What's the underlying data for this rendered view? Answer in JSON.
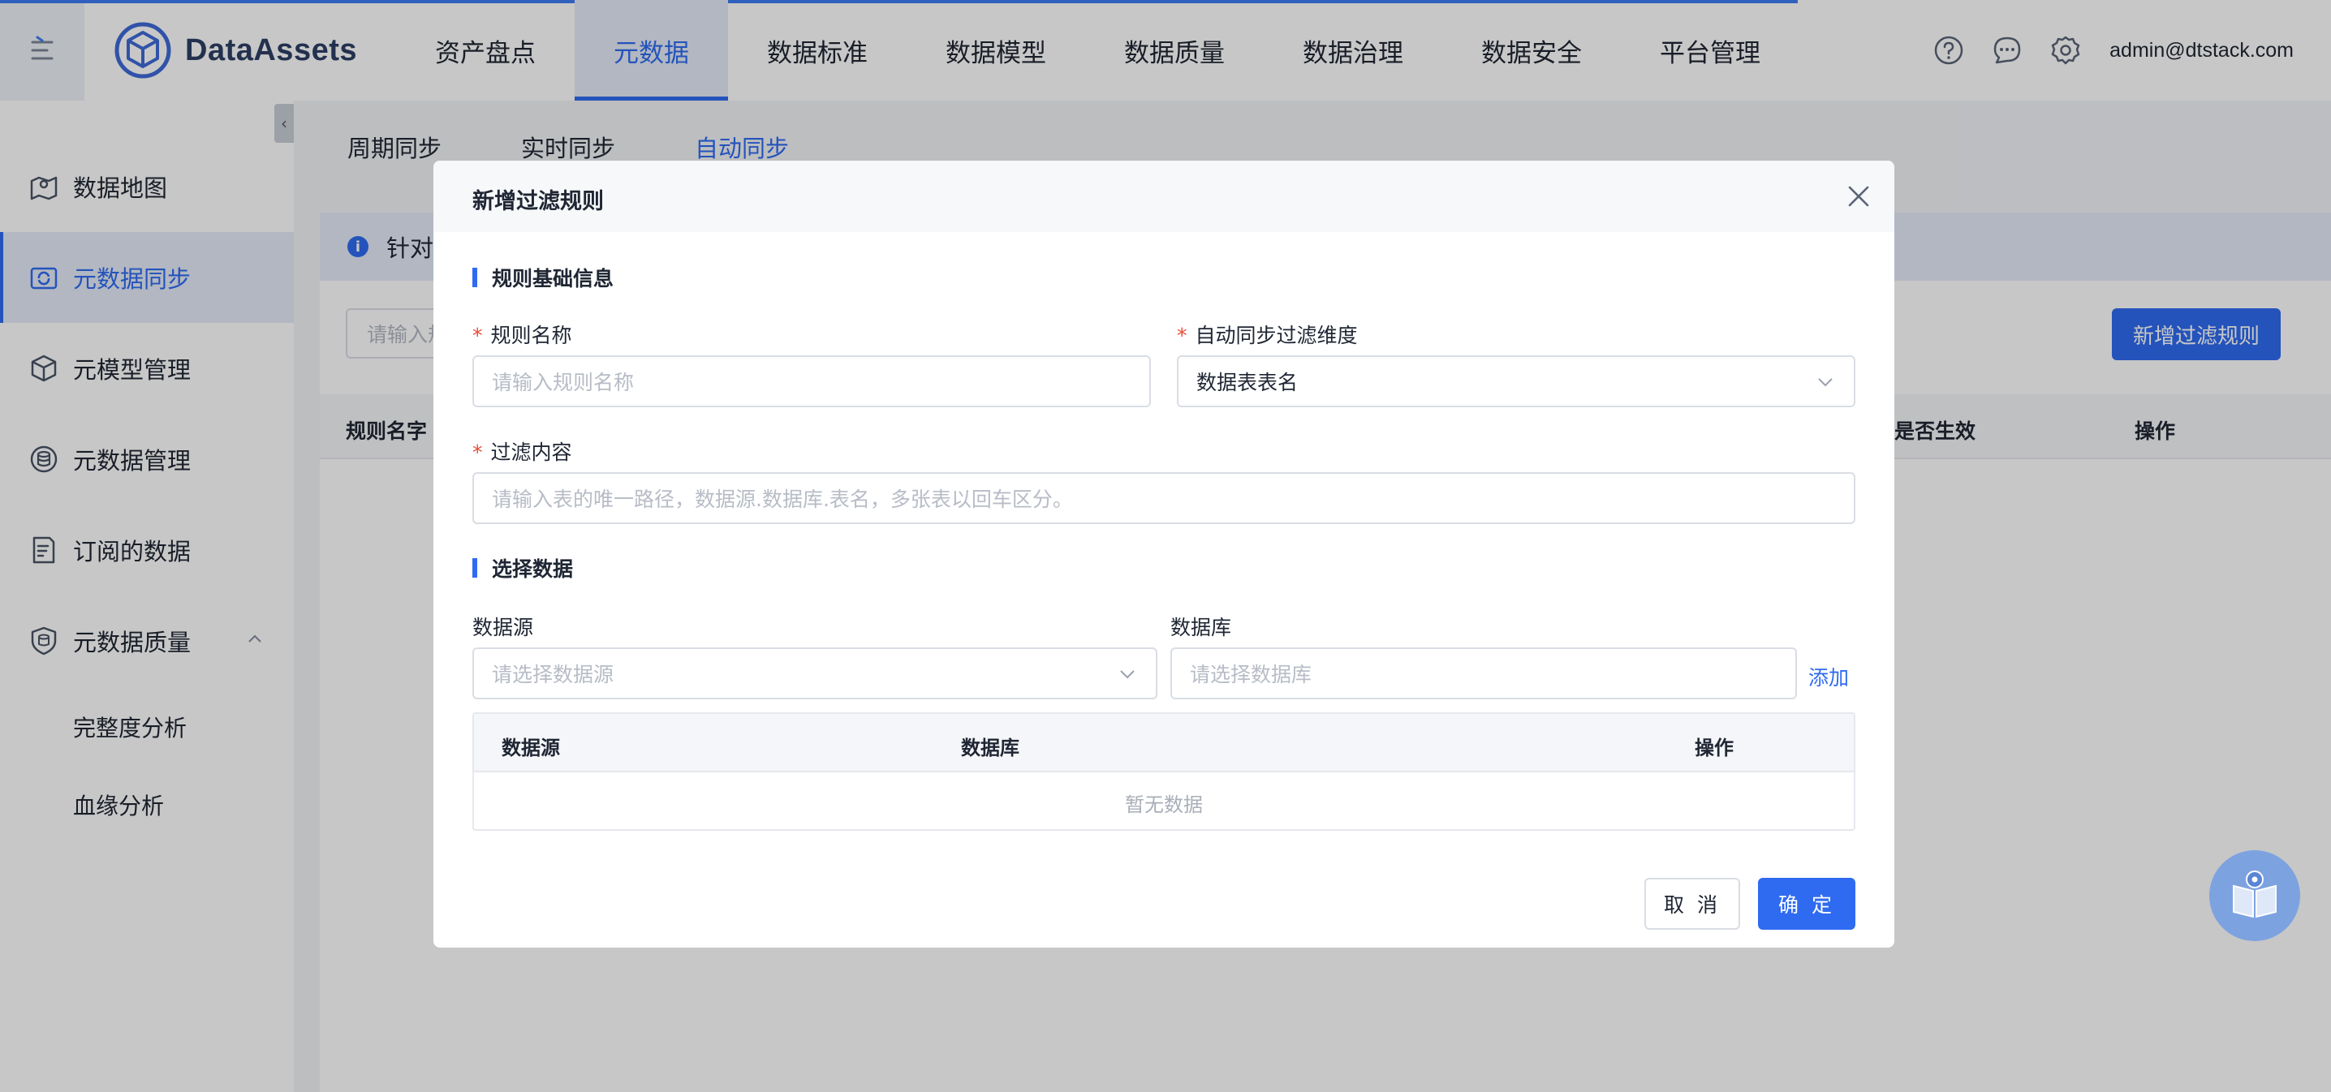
{
  "header": {
    "logo_text": "DataAssets",
    "nav": [
      "资产盘点",
      "元数据",
      "数据标准",
      "数据模型",
      "数据质量",
      "数据治理",
      "数据安全",
      "平台管理"
    ],
    "active_nav_index": 1,
    "user": "admin@dtstack.com",
    "icons": [
      "help-icon",
      "message-icon",
      "settings-icon"
    ]
  },
  "sidebar": {
    "items": [
      {
        "label": "数据地图",
        "icon": "map-icon"
      },
      {
        "label": "元数据同步",
        "icon": "sync-icon"
      },
      {
        "label": "元模型管理",
        "icon": "cube-icon"
      },
      {
        "label": "元数据管理",
        "icon": "database-icon"
      },
      {
        "label": "订阅的数据",
        "icon": "subscribe-icon"
      },
      {
        "label": "元数据质量",
        "icon": "shield-icon"
      }
    ],
    "active_index": 1,
    "sub_items": [
      "完整度分析",
      "血缘分析"
    ]
  },
  "content": {
    "subtabs": [
      "周期同步",
      "实时同步",
      "自动同步"
    ],
    "active_subtab_index": 2,
    "info_text": "针对",
    "search_placeholder": "请输入规",
    "add_rule_button": "新增过滤规则",
    "table_columns": [
      "规则名字",
      "是否生效",
      "操作"
    ]
  },
  "modal": {
    "title": "新增过滤规则",
    "section_basic": "规则基础信息",
    "rule_name_label": "规则名称",
    "rule_name_placeholder": "请输入规则名称",
    "dimension_label": "自动同步过滤维度",
    "dimension_value": "数据表表名",
    "filter_label": "过滤内容",
    "filter_placeholder": "请输入表的唯一路径，数据源.数据库.表名，多张表以回车区分。",
    "section_select": "选择数据",
    "datasource_label": "数据源",
    "datasource_placeholder": "请选择数据源",
    "database_label": "数据库",
    "database_placeholder": "请选择数据库",
    "add_link": "添加",
    "table_columns": [
      "数据源",
      "数据库",
      "操作"
    ],
    "empty_text": "暂无数据",
    "cancel": "取 消",
    "ok": "确 定"
  },
  "colors": {
    "primary": "#2f6bf0",
    "required": "#e94c3a",
    "brand_text": "#2e3f66"
  }
}
